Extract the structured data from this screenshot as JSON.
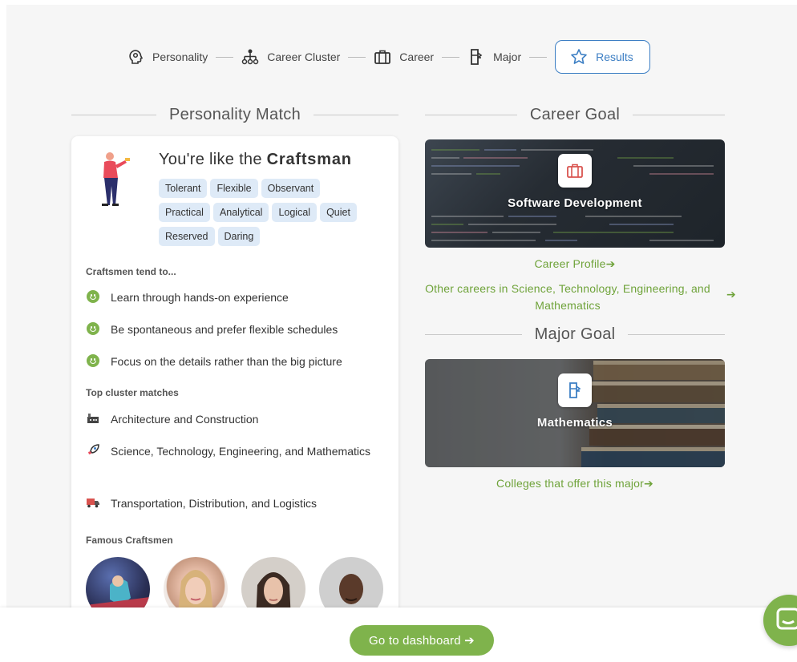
{
  "stepper": {
    "steps": [
      {
        "label": "Personality",
        "icon": "head-icon"
      },
      {
        "label": "Career Cluster",
        "icon": "org-chart-icon"
      },
      {
        "label": "Career",
        "icon": "briefcase-icon"
      },
      {
        "label": "Major",
        "icon": "book-icon"
      },
      {
        "label": "Results",
        "icon": "star-icon"
      }
    ],
    "active_step": "Results"
  },
  "personality": {
    "section_title": "Personality Match",
    "like_prefix": "You're like the ",
    "type_name": "Craftsman",
    "traits": [
      "Tolerant",
      "Flexible",
      "Observant",
      "Practical",
      "Analytical",
      "Logical",
      "Quiet",
      "Reserved",
      "Daring"
    ],
    "tend_heading": "Craftsmen tend to...",
    "tendencies": [
      "Learn through hands-on experience",
      "Be spontaneous and prefer flexible schedules",
      "Focus on the details rather than the big picture"
    ],
    "cluster_heading": "Top cluster matches",
    "clusters": [
      {
        "label": "Architecture and Construction",
        "icon": "factory-icon"
      },
      {
        "label": "Science, Technology, Engineering, and Mathematics",
        "icon": "rocket-icon"
      },
      {
        "label": "Transportation, Distribution, and Logistics",
        "icon": "truck-icon"
      }
    ],
    "famous_heading": "Famous Craftsmen"
  },
  "career_goal": {
    "section_title": "Career Goal",
    "name": "Software Development",
    "profile_link": "Career Profile",
    "other_link": "Other careers in Science, Technology, Engineering, and Mathematics"
  },
  "major_goal": {
    "section_title": "Major Goal",
    "name": "Mathematics",
    "colleges_link": "Colleges that offer this major"
  },
  "footer": {
    "dashboard_button": "Go to dashboard"
  },
  "colors": {
    "accent_green": "#7fb34c",
    "link_green": "#6fa33a",
    "active_blue": "#3d7fc4",
    "trait_bg": "#deeaf7",
    "career_icon": "#d9534f",
    "major_icon": "#3d7fc4"
  }
}
